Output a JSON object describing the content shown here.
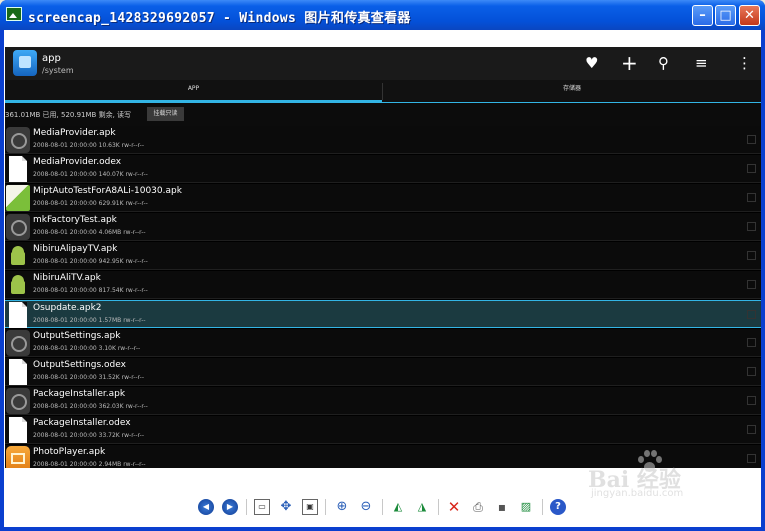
{
  "window": {
    "title": "screencap_1428329692057 - Windows 图片和传真查看器",
    "min_glyph": "–",
    "max_glyph": "□",
    "close_glyph": "✕"
  },
  "actionbar": {
    "title": "app",
    "path": "/system",
    "favorite_icon": "♥",
    "add_icon": "+",
    "search_icon": "⚲",
    "sort_icon": "≡",
    "menu_icon": "⋮"
  },
  "tabs": [
    {
      "label": "APP"
    },
    {
      "label": "存储器"
    }
  ],
  "status": {
    "text": "361.01MB 已用, 520.91MB 剩余, 读写",
    "button": "挂载只读"
  },
  "files": [
    {
      "name": "MediaProvider.apk",
      "meta": "2008-08-01 20:00:00  10.63K  rw-r--r--",
      "icon": "gear"
    },
    {
      "name": "MediaProvider.odex",
      "meta": "2008-08-01 20:00:00  140.07K  rw-r--r--",
      "icon": "doc"
    },
    {
      "name": "MiptAutoTestForA8ALi-10030.apk",
      "meta": "2008-08-01 20:00:00  629.91K  rw-r--r--",
      "icon": "mipt"
    },
    {
      "name": "mkFactoryTest.apk",
      "meta": "2008-08-01 20:00:00  4.06MB  rw-r--r--",
      "icon": "gear"
    },
    {
      "name": "NibiruAlipayTV.apk",
      "meta": "2008-08-01 20:00:00  942.95K  rw-r--r--",
      "icon": "android"
    },
    {
      "name": "NibiruAliTV.apk",
      "meta": "2008-08-01 20:00:00  817.54K  rw-r--r--",
      "icon": "android"
    },
    {
      "name": "Osupdate.apk2",
      "meta": "2008-08-01 20:00:00  1.57MB  rw-r--r--",
      "icon": "doc",
      "selected": true
    },
    {
      "name": "OutputSettings.apk",
      "meta": "2008-08-01 20:00:00  3.10K  rw-r--r--",
      "icon": "gear"
    },
    {
      "name": "OutputSettings.odex",
      "meta": "2008-08-01 20:00:00  31.52K  rw-r--r--",
      "icon": "doc"
    },
    {
      "name": "PackageInstaller.apk",
      "meta": "2008-08-01 20:00:00  362.03K  rw-r--r--",
      "icon": "gear"
    },
    {
      "name": "PackageInstaller.odex",
      "meta": "2008-08-01 20:00:00  33.72K  rw-r--r--",
      "icon": "doc"
    },
    {
      "name": "PhotoPlayer.apk",
      "meta": "2008-08-01 20:00:00  2.94MB  rw-r--r--",
      "icon": "photo"
    }
  ],
  "toolbar": {
    "prev_glyph": "◀",
    "next_glyph": "▶",
    "best_fit_glyph": "▭",
    "actual_size_glyph": "✥",
    "slideshow_glyph": "▣",
    "zoom_in_glyph": "⊕",
    "zoom_out_glyph": "⊖",
    "rotate_cw_glyph": "◭",
    "rotate_ccw_glyph": "◮",
    "delete_glyph": "✕",
    "print_glyph": "⎙",
    "save_glyph": "▪",
    "edit_glyph": "▨",
    "help_glyph": "?"
  },
  "watermark": {
    "text": "Bai  经验",
    "sub": "jingyan.baidu.com"
  },
  "colors": {
    "titlebar": "#0451d9",
    "accent": "#33b5e5",
    "selected_row": "#1b3a40"
  }
}
